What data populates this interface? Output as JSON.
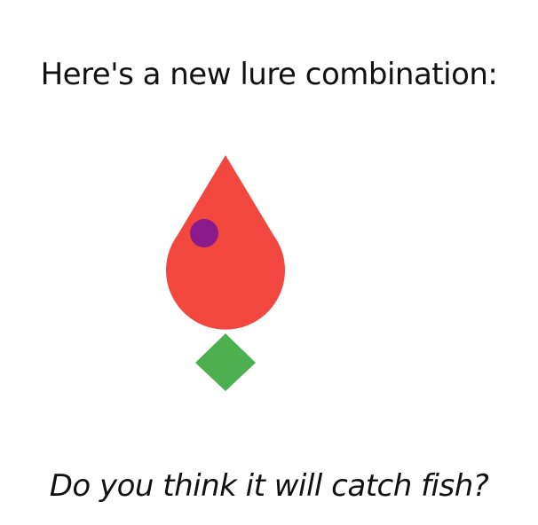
{
  "heading": "Here's a new lure combination:",
  "question": "Do you think it will catch fish?",
  "lure": {
    "body_shape": "teardrop",
    "body_color": "#f2473f",
    "eye_shape": "circle",
    "eye_color": "#8a1a8a",
    "tail_shape": "diamond",
    "tail_color": "#4caf50"
  }
}
